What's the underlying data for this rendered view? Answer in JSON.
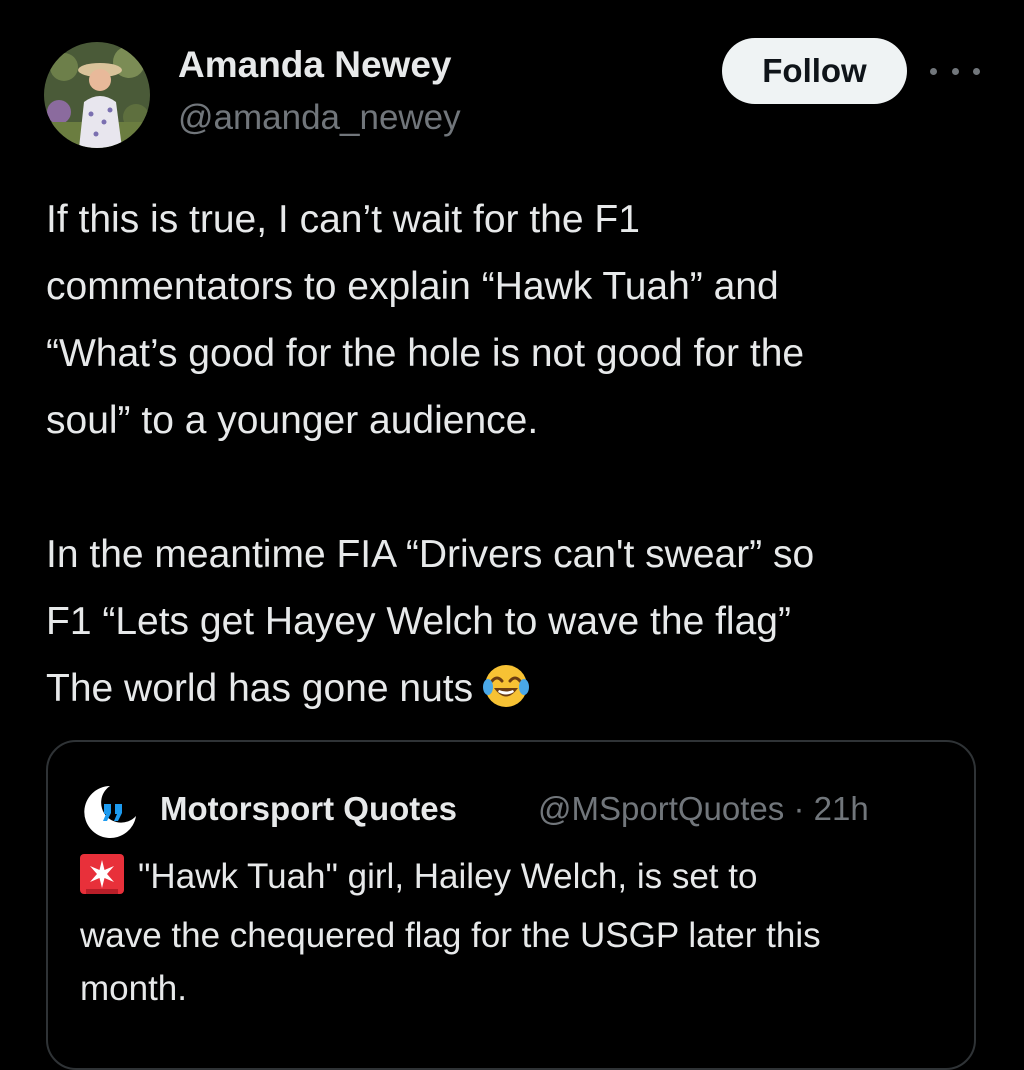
{
  "author": {
    "display_name": "Amanda Newey",
    "handle": "@amanda_newey",
    "avatar_icon": "profile-photo"
  },
  "actions": {
    "follow_label": "Follow",
    "more_icon": "more-horizontal-icon"
  },
  "tweet": {
    "lines": [
      "If this is true, I can’t wait for the F1",
      "commentators to explain “Hawk Tuah” and",
      "“What’s good for the hole is not good for the",
      "soul” to a younger audience.",
      "",
      "In the meantime FIA “Drivers can't swear” so",
      "F1 “Lets get Hayey Welch to wave the flag”",
      "The world has gone nuts"
    ],
    "trailing_emoji": "face-with-tears-of-joy"
  },
  "quoted_tweet": {
    "display_name": "Motorsport Quotes",
    "handle": "@MSportQuotes",
    "separator": "·",
    "time": "21h",
    "avatar_icon": "quote-marks-logo",
    "leading_emoji": "police-light",
    "lines": [
      "\"Hawk Tuah\" girl, Hailey Welch, is set to",
      "wave the chequered flag for the USGP later this",
      "month."
    ]
  },
  "colors": {
    "background": "#000000",
    "text_primary": "#e7e9ea",
    "text_secondary": "#71767b",
    "follow_bg": "#eff3f4",
    "follow_text": "#0f1419",
    "card_border": "#2f3336",
    "accent_blue": "#1d9bf0"
  }
}
